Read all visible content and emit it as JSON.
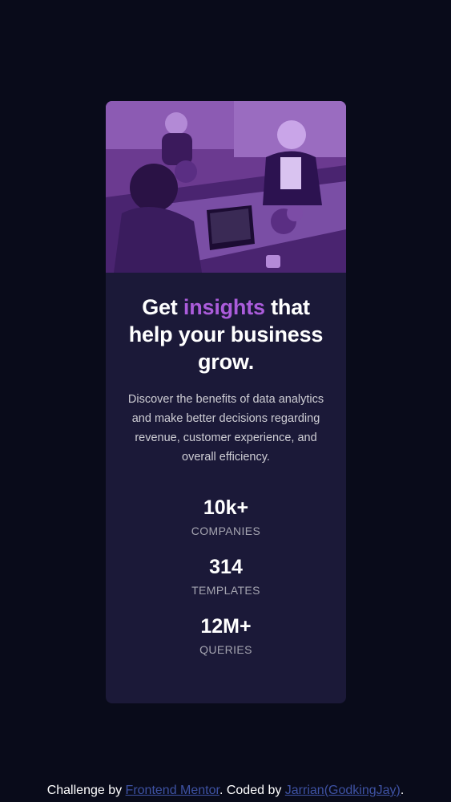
{
  "card": {
    "image_alt": "Three women working at a table with laptops",
    "headline_before": "Get ",
    "headline_accent": "insights",
    "headline_after": " that help your business grow.",
    "description": "Discover the benefits of data analytics and make better decisions regarding revenue, customer experience, and overall efficiency.",
    "stats": [
      {
        "value": "10k+",
        "label": "Companies"
      },
      {
        "value": "314",
        "label": "Templates"
      },
      {
        "value": "12M+",
        "label": "Queries"
      }
    ]
  },
  "attribution": {
    "prefix": "Challenge by ",
    "link1": "Frontend Mentor",
    "middle": ". Coded by ",
    "link2": "Jarrian(GodkingJay)",
    "suffix": "."
  },
  "colors": {
    "page_bg": "#090b1a",
    "card_bg": "#1b1938",
    "accent": "#ab5cdb",
    "link": "#3e52a3"
  }
}
